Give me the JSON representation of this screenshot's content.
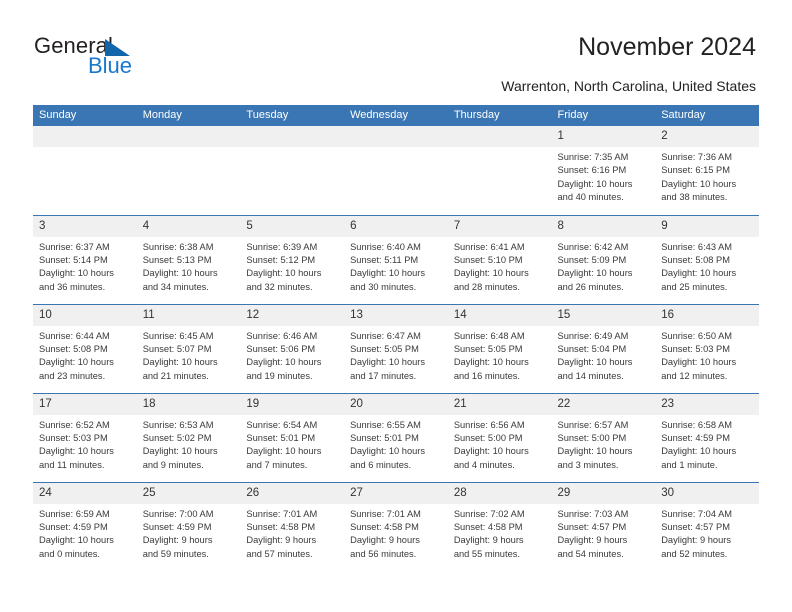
{
  "brand": {
    "name_part1": "General",
    "name_part2": "Blue",
    "triangle_icon": "blue-triangle-icon",
    "color_dark": "#231f20",
    "color_blue": "#1878cf",
    "color_triangle": "#1065ab"
  },
  "header": {
    "title": "November 2024",
    "location": "Warrenton, North Carolina, United States"
  },
  "theme": {
    "header_blue": "#3b76b4",
    "daynum_bg": "#f0f0f0",
    "text": "#3a3a3a"
  },
  "calendar": {
    "weekday_headers": [
      "Sunday",
      "Monday",
      "Tuesday",
      "Wednesday",
      "Thursday",
      "Friday",
      "Saturday"
    ],
    "weeks": [
      [
        {
          "day": "",
          "empty": true,
          "sunrise": "",
          "sunset": "",
          "daylight_line1": "",
          "daylight_line2": ""
        },
        {
          "day": "",
          "empty": true,
          "sunrise": "",
          "sunset": "",
          "daylight_line1": "",
          "daylight_line2": ""
        },
        {
          "day": "",
          "empty": true,
          "sunrise": "",
          "sunset": "",
          "daylight_line1": "",
          "daylight_line2": ""
        },
        {
          "day": "",
          "empty": true,
          "sunrise": "",
          "sunset": "",
          "daylight_line1": "",
          "daylight_line2": ""
        },
        {
          "day": "",
          "empty": true,
          "sunrise": "",
          "sunset": "",
          "daylight_line1": "",
          "daylight_line2": ""
        },
        {
          "day": "1",
          "empty": false,
          "sunrise": "Sunrise: 7:35 AM",
          "sunset": "Sunset: 6:16 PM",
          "daylight_line1": "Daylight: 10 hours",
          "daylight_line2": "and 40 minutes."
        },
        {
          "day": "2",
          "empty": false,
          "sunrise": "Sunrise: 7:36 AM",
          "sunset": "Sunset: 6:15 PM",
          "daylight_line1": "Daylight: 10 hours",
          "daylight_line2": "and 38 minutes."
        }
      ],
      [
        {
          "day": "3",
          "empty": false,
          "sunrise": "Sunrise: 6:37 AM",
          "sunset": "Sunset: 5:14 PM",
          "daylight_line1": "Daylight: 10 hours",
          "daylight_line2": "and 36 minutes."
        },
        {
          "day": "4",
          "empty": false,
          "sunrise": "Sunrise: 6:38 AM",
          "sunset": "Sunset: 5:13 PM",
          "daylight_line1": "Daylight: 10 hours",
          "daylight_line2": "and 34 minutes."
        },
        {
          "day": "5",
          "empty": false,
          "sunrise": "Sunrise: 6:39 AM",
          "sunset": "Sunset: 5:12 PM",
          "daylight_line1": "Daylight: 10 hours",
          "daylight_line2": "and 32 minutes."
        },
        {
          "day": "6",
          "empty": false,
          "sunrise": "Sunrise: 6:40 AM",
          "sunset": "Sunset: 5:11 PM",
          "daylight_line1": "Daylight: 10 hours",
          "daylight_line2": "and 30 minutes."
        },
        {
          "day": "7",
          "empty": false,
          "sunrise": "Sunrise: 6:41 AM",
          "sunset": "Sunset: 5:10 PM",
          "daylight_line1": "Daylight: 10 hours",
          "daylight_line2": "and 28 minutes."
        },
        {
          "day": "8",
          "empty": false,
          "sunrise": "Sunrise: 6:42 AM",
          "sunset": "Sunset: 5:09 PM",
          "daylight_line1": "Daylight: 10 hours",
          "daylight_line2": "and 26 minutes."
        },
        {
          "day": "9",
          "empty": false,
          "sunrise": "Sunrise: 6:43 AM",
          "sunset": "Sunset: 5:08 PM",
          "daylight_line1": "Daylight: 10 hours",
          "daylight_line2": "and 25 minutes."
        }
      ],
      [
        {
          "day": "10",
          "empty": false,
          "sunrise": "Sunrise: 6:44 AM",
          "sunset": "Sunset: 5:08 PM",
          "daylight_line1": "Daylight: 10 hours",
          "daylight_line2": "and 23 minutes."
        },
        {
          "day": "11",
          "empty": false,
          "sunrise": "Sunrise: 6:45 AM",
          "sunset": "Sunset: 5:07 PM",
          "daylight_line1": "Daylight: 10 hours",
          "daylight_line2": "and 21 minutes."
        },
        {
          "day": "12",
          "empty": false,
          "sunrise": "Sunrise: 6:46 AM",
          "sunset": "Sunset: 5:06 PM",
          "daylight_line1": "Daylight: 10 hours",
          "daylight_line2": "and 19 minutes."
        },
        {
          "day": "13",
          "empty": false,
          "sunrise": "Sunrise: 6:47 AM",
          "sunset": "Sunset: 5:05 PM",
          "daylight_line1": "Daylight: 10 hours",
          "daylight_line2": "and 17 minutes."
        },
        {
          "day": "14",
          "empty": false,
          "sunrise": "Sunrise: 6:48 AM",
          "sunset": "Sunset: 5:05 PM",
          "daylight_line1": "Daylight: 10 hours",
          "daylight_line2": "and 16 minutes."
        },
        {
          "day": "15",
          "empty": false,
          "sunrise": "Sunrise: 6:49 AM",
          "sunset": "Sunset: 5:04 PM",
          "daylight_line1": "Daylight: 10 hours",
          "daylight_line2": "and 14 minutes."
        },
        {
          "day": "16",
          "empty": false,
          "sunrise": "Sunrise: 6:50 AM",
          "sunset": "Sunset: 5:03 PM",
          "daylight_line1": "Daylight: 10 hours",
          "daylight_line2": "and 12 minutes."
        }
      ],
      [
        {
          "day": "17",
          "empty": false,
          "sunrise": "Sunrise: 6:52 AM",
          "sunset": "Sunset: 5:03 PM",
          "daylight_line1": "Daylight: 10 hours",
          "daylight_line2": "and 11 minutes."
        },
        {
          "day": "18",
          "empty": false,
          "sunrise": "Sunrise: 6:53 AM",
          "sunset": "Sunset: 5:02 PM",
          "daylight_line1": "Daylight: 10 hours",
          "daylight_line2": "and 9 minutes."
        },
        {
          "day": "19",
          "empty": false,
          "sunrise": "Sunrise: 6:54 AM",
          "sunset": "Sunset: 5:01 PM",
          "daylight_line1": "Daylight: 10 hours",
          "daylight_line2": "and 7 minutes."
        },
        {
          "day": "20",
          "empty": false,
          "sunrise": "Sunrise: 6:55 AM",
          "sunset": "Sunset: 5:01 PM",
          "daylight_line1": "Daylight: 10 hours",
          "daylight_line2": "and 6 minutes."
        },
        {
          "day": "21",
          "empty": false,
          "sunrise": "Sunrise: 6:56 AM",
          "sunset": "Sunset: 5:00 PM",
          "daylight_line1": "Daylight: 10 hours",
          "daylight_line2": "and 4 minutes."
        },
        {
          "day": "22",
          "empty": false,
          "sunrise": "Sunrise: 6:57 AM",
          "sunset": "Sunset: 5:00 PM",
          "daylight_line1": "Daylight: 10 hours",
          "daylight_line2": "and 3 minutes."
        },
        {
          "day": "23",
          "empty": false,
          "sunrise": "Sunrise: 6:58 AM",
          "sunset": "Sunset: 4:59 PM",
          "daylight_line1": "Daylight: 10 hours",
          "daylight_line2": "and 1 minute."
        }
      ],
      [
        {
          "day": "24",
          "empty": false,
          "sunrise": "Sunrise: 6:59 AM",
          "sunset": "Sunset: 4:59 PM",
          "daylight_line1": "Daylight: 10 hours",
          "daylight_line2": "and 0 minutes."
        },
        {
          "day": "25",
          "empty": false,
          "sunrise": "Sunrise: 7:00 AM",
          "sunset": "Sunset: 4:59 PM",
          "daylight_line1": "Daylight: 9 hours",
          "daylight_line2": "and 59 minutes."
        },
        {
          "day": "26",
          "empty": false,
          "sunrise": "Sunrise: 7:01 AM",
          "sunset": "Sunset: 4:58 PM",
          "daylight_line1": "Daylight: 9 hours",
          "daylight_line2": "and 57 minutes."
        },
        {
          "day": "27",
          "empty": false,
          "sunrise": "Sunrise: 7:01 AM",
          "sunset": "Sunset: 4:58 PM",
          "daylight_line1": "Daylight: 9 hours",
          "daylight_line2": "and 56 minutes."
        },
        {
          "day": "28",
          "empty": false,
          "sunrise": "Sunrise: 7:02 AM",
          "sunset": "Sunset: 4:58 PM",
          "daylight_line1": "Daylight: 9 hours",
          "daylight_line2": "and 55 minutes."
        },
        {
          "day": "29",
          "empty": false,
          "sunrise": "Sunrise: 7:03 AM",
          "sunset": "Sunset: 4:57 PM",
          "daylight_line1": "Daylight: 9 hours",
          "daylight_line2": "and 54 minutes."
        },
        {
          "day": "30",
          "empty": false,
          "sunrise": "Sunrise: 7:04 AM",
          "sunset": "Sunset: 4:57 PM",
          "daylight_line1": "Daylight: 9 hours",
          "daylight_line2": "and 52 minutes."
        }
      ]
    ]
  }
}
